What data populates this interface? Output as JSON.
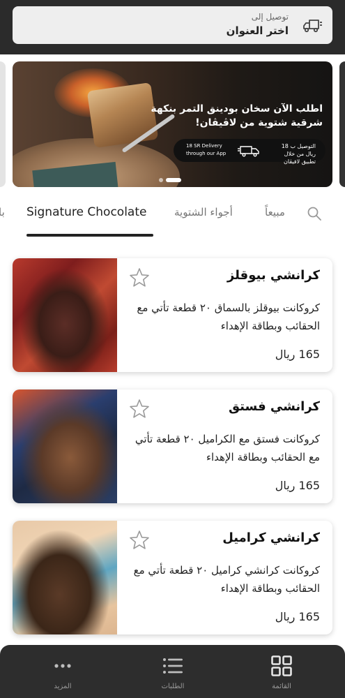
{
  "header": {
    "deliver_to_label": "توصيل إلى",
    "address_value": "اختر العنوان",
    "icon": "delivery-truck-icon"
  },
  "banner": {
    "title": "اطلب الآن سخان بودينق التمر بنكهة شرقية شتوية من لاڤيڤان!",
    "pill_arabic": "التوصيل ب 18 ريال من خلال تطبيق لافيڤان",
    "pill_english": "18 SR Delivery through our App",
    "slides_count": 2,
    "active_slide": 2
  },
  "categories": {
    "tabs": [
      {
        "label": "Signature Chocolate",
        "active": true
      },
      {
        "label": "أجواء الشتوية",
        "active": false
      },
      {
        "label": "مبيعاً",
        "active": false
      },
      {
        "label": "با",
        "active": false
      }
    ]
  },
  "products": [
    {
      "name": "كرانشي بيوقلز",
      "description": "كروكانت بيوقلز بالسماق ٢٠ قطعة  تأتي مع الحقائب وبطاقة الإهداء",
      "price": "165 ريال"
    },
    {
      "name": "كرانشي فستق",
      "description": "كروكانت فستق مع الكراميل ٢٠ قطعة  تأتي مع الحقائب وبطاقة الإهداء",
      "price": "165 ريال"
    },
    {
      "name": "كرانشي كراميل",
      "description": "كروكانت كرانشي كراميل ٢٠ قطعة  تأتي مع الحقائب وبطاقة الإهداء",
      "price": "165 ريال"
    }
  ],
  "bottom_nav": {
    "items": [
      {
        "label": "المزيد",
        "icon": "more-dots-icon"
      },
      {
        "label": "الطلبات",
        "icon": "list-icon"
      },
      {
        "label": "القائمة",
        "icon": "grid-icon",
        "active": true
      }
    ]
  },
  "colors": {
    "topbar": "#2b2b2b",
    "bottom_nav": "#2d2d2d",
    "accent_dark": "#222222"
  }
}
